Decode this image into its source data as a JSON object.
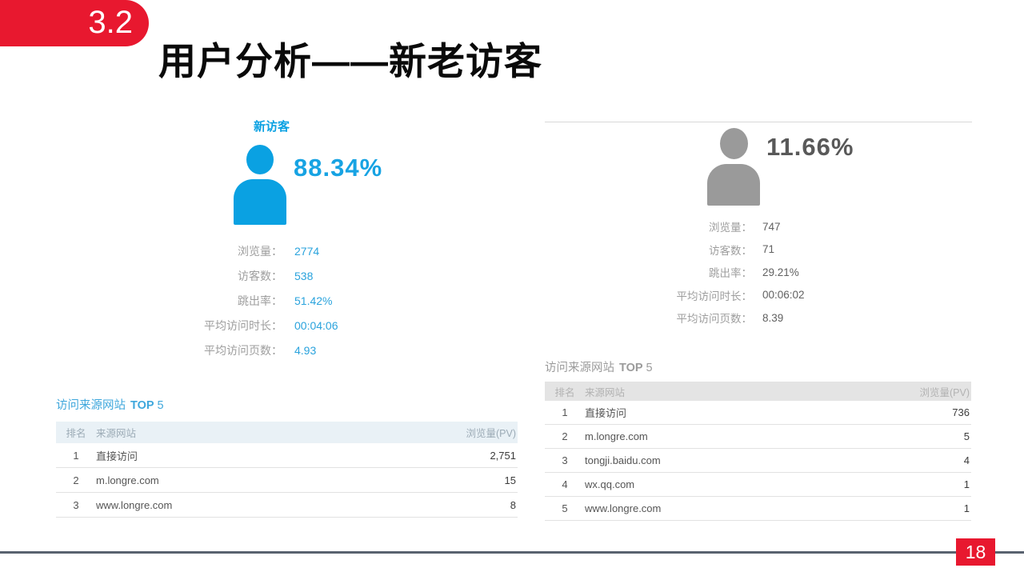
{
  "slide": {
    "section_number": "3.2",
    "title": "用户分析——新老访客",
    "page_number": "18"
  },
  "colors": {
    "accent_red": "#e8182f",
    "accent_blue": "#0aa1e2",
    "icon_gray": "#9a9a9a"
  },
  "new_visitors": {
    "label": "新访客",
    "icon": "person-icon-blue",
    "percent": "88.34%",
    "stats": [
      {
        "label": "浏览量：",
        "value": "2774"
      },
      {
        "label": "访客数：",
        "value": "538"
      },
      {
        "label": "跳出率：",
        "value": "51.42%"
      },
      {
        "label": "平均访问时长：",
        "value": "00:04:06"
      },
      {
        "label": "平均访问页数：",
        "value": "4.93"
      }
    ],
    "table": {
      "title_text": "访问来源网站",
      "top_label": "TOP",
      "top_n": "5",
      "headers": {
        "rank": "排名",
        "site": "来源网站",
        "pv": "浏览量(PV)"
      },
      "rows": [
        {
          "rank": "1",
          "site": "直接访问",
          "pv": "2,751"
        },
        {
          "rank": "2",
          "site": "m.longre.com",
          "pv": "15"
        },
        {
          "rank": "3",
          "site": "www.longre.com",
          "pv": "8"
        }
      ]
    }
  },
  "returning_visitors": {
    "icon": "person-icon-gray",
    "percent": "11.66%",
    "stats": [
      {
        "label": "浏览量：",
        "value": "747"
      },
      {
        "label": "访客数：",
        "value": "71"
      },
      {
        "label": "跳出率：",
        "value": "29.21%"
      },
      {
        "label": "平均访问时长：",
        "value": "00:06:02"
      },
      {
        "label": "平均访问页数：",
        "value": "8.39"
      }
    ],
    "table": {
      "title_text": "访问来源网站",
      "top_label": "TOP",
      "top_n": "5",
      "headers": {
        "rank": "排名",
        "site": "来源网站",
        "pv": "浏览量(PV)"
      },
      "rows": [
        {
          "rank": "1",
          "site": "直接访问",
          "pv": "736"
        },
        {
          "rank": "2",
          "site": "m.longre.com",
          "pv": "5"
        },
        {
          "rank": "3",
          "site": "tongji.baidu.com",
          "pv": "4"
        },
        {
          "rank": "4",
          "site": "wx.qq.com",
          "pv": "1"
        },
        {
          "rank": "5",
          "site": "www.longre.com",
          "pv": "1"
        }
      ]
    }
  }
}
